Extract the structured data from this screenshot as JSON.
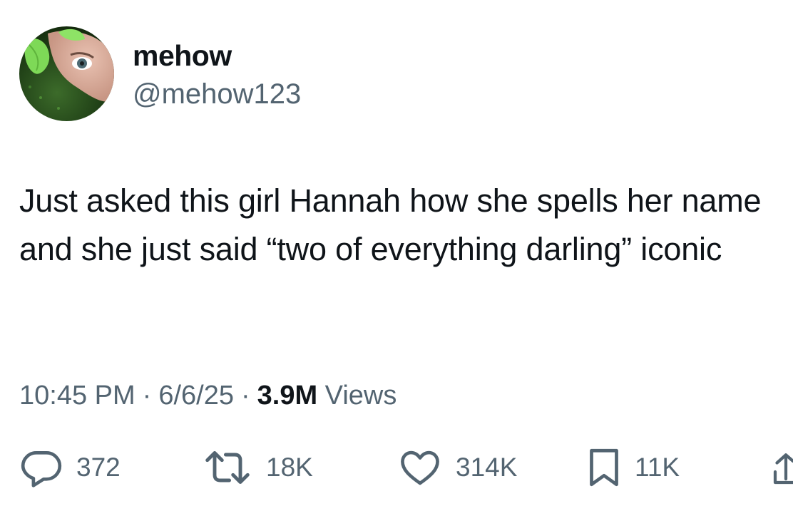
{
  "author": {
    "display_name": "mehow",
    "handle": "@mehow123"
  },
  "tweet": {
    "text": "Just asked this girl Hannah how she spells her name and she just said “two of everything darling” iconic"
  },
  "meta": {
    "time": "10:45 PM",
    "separator": "·",
    "date": "6/6/25",
    "views_count": "3.9M",
    "views_label": "Views"
  },
  "actions": {
    "replies": "372",
    "reposts": "18K",
    "likes": "314K",
    "bookmarks": "11K"
  },
  "icons": {
    "reply": "reply-icon",
    "repost": "repost-icon",
    "like": "heart-icon",
    "bookmark": "bookmark-icon",
    "share": "share-icon"
  },
  "colors": {
    "text_primary": "#0f1419",
    "text_secondary": "#536471",
    "icon": "#536471"
  }
}
